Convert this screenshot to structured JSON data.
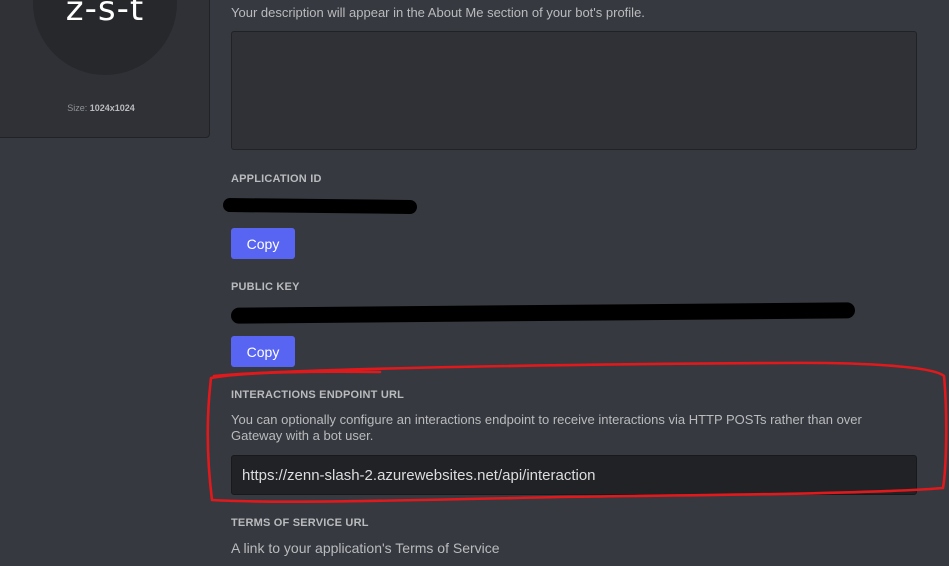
{
  "avatar": {
    "initials": "z-s-t",
    "size_prefix": "Size:",
    "size_value": "1024x1024"
  },
  "description": {
    "hint": "Your description will appear in the About Me section of your bot's profile.",
    "value": ""
  },
  "application_id": {
    "label": "APPLICATION ID",
    "copy_label": "Copy"
  },
  "public_key": {
    "label": "PUBLIC KEY",
    "copy_label": "Copy"
  },
  "interactions": {
    "label": "INTERACTIONS ENDPOINT URL",
    "hint": "You can optionally configure an interactions endpoint to receive interactions via HTTP POSTs rather than over Gateway with a bot user.",
    "value": "https://zenn-slash-2.azurewebsites.net/api/interaction"
  },
  "terms": {
    "label": "TERMS OF SERVICE URL",
    "hint": "A link to your application's Terms of Service"
  },
  "colors": {
    "background": "#36393f",
    "button": "#5865f2",
    "annotation": "#e0191c"
  }
}
